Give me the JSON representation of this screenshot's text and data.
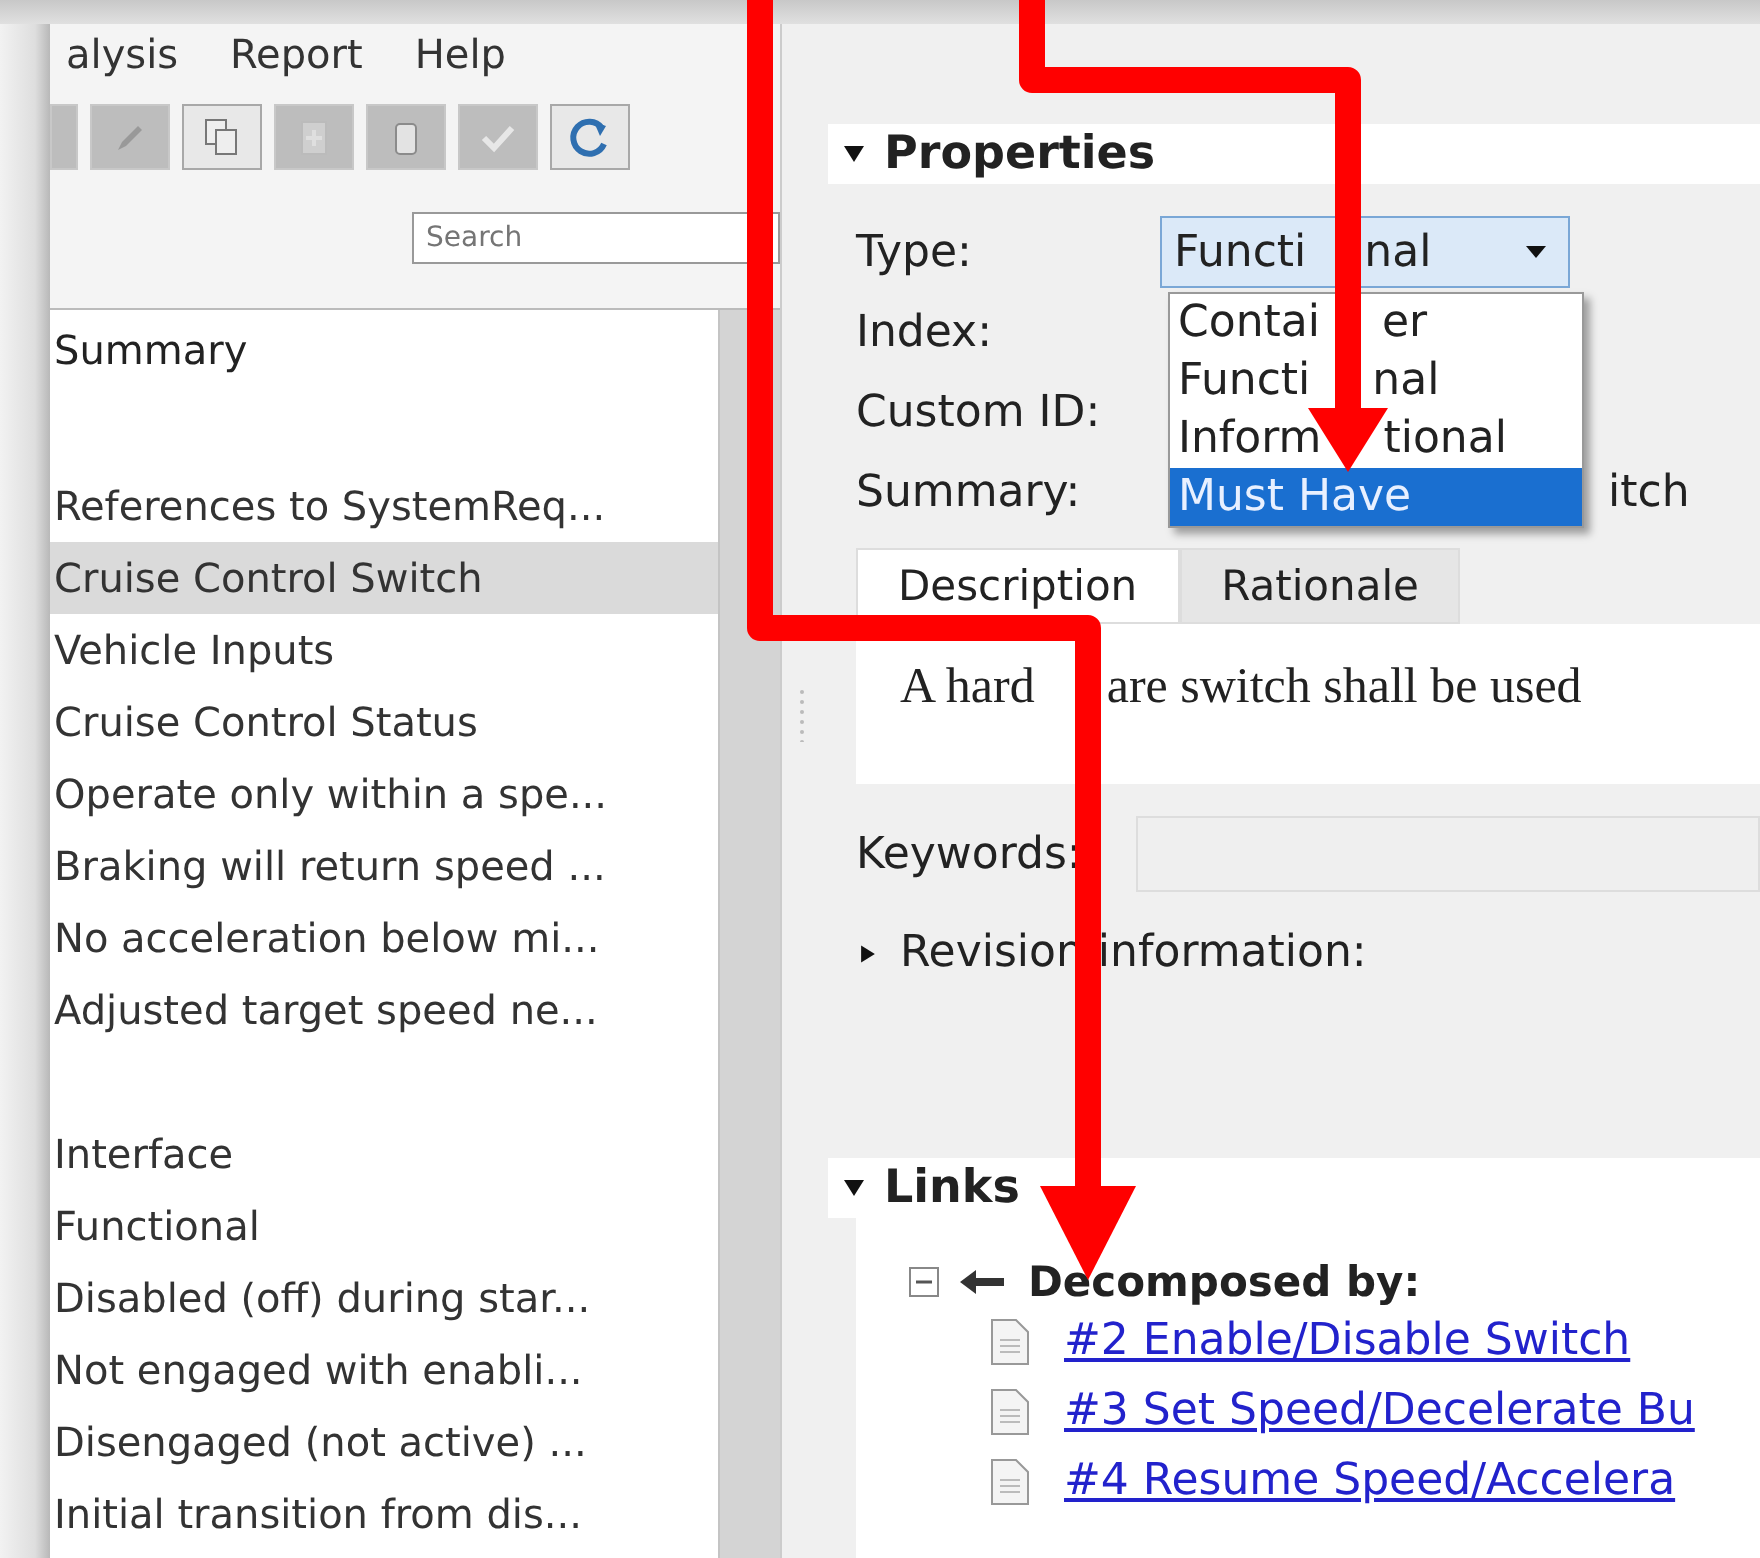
{
  "menu": [
    "alysis",
    "Report",
    "Help"
  ],
  "toolbar": [
    {
      "kind": "blank",
      "disabled": true
    },
    {
      "kind": "pencil",
      "disabled": true
    },
    {
      "kind": "copy",
      "disabled": false
    },
    {
      "kind": "add",
      "disabled": true
    },
    {
      "kind": "trash",
      "disabled": true
    },
    {
      "kind": "check",
      "disabled": true
    },
    {
      "kind": "refresh",
      "disabled": false
    }
  ],
  "search": {
    "placeholder": "Search"
  },
  "list": {
    "header": "Summary",
    "groups": [
      {
        "items": [
          {
            "label": "References to SystemReq...",
            "selected": false
          },
          {
            "label": "Cruise Control Switch",
            "selected": true
          },
          {
            "label": "Vehicle Inputs",
            "selected": false
          },
          {
            "label": "Cruise Control Status",
            "selected": false
          },
          {
            "label": "Operate only within a spe...",
            "selected": false
          },
          {
            "label": "Braking will return speed ...",
            "selected": false
          },
          {
            "label": "No acceleration below mi...",
            "selected": false
          },
          {
            "label": "Adjusted target speed ne...",
            "selected": false
          }
        ]
      },
      {
        "items": [
          {
            "label": "Interface",
            "selected": false
          },
          {
            "label": "Functional",
            "selected": false
          },
          {
            "label": "Disabled (off) during star...",
            "selected": false
          },
          {
            "label": "Not engaged with enabli...",
            "selected": false
          },
          {
            "label": "Disengaged (not active) ...",
            "selected": false
          },
          {
            "label": "Initial transition from dis...",
            "selected": false
          }
        ]
      }
    ]
  },
  "properties": {
    "title": "Properties",
    "expanded": true,
    "type": {
      "label": "Type:",
      "value": [
        "Functi",
        "nal"
      ],
      "options": [
        {
          "label": [
            "Contai",
            "er"
          ],
          "selected": false
        },
        {
          "label": [
            "Functi",
            "nal"
          ],
          "selected": false
        },
        {
          "label": [
            "Inform",
            "tional"
          ],
          "selected": false
        },
        {
          "label": [
            "Must Have"
          ],
          "selected": true
        }
      ]
    },
    "index": {
      "label": "Index:"
    },
    "custom_id": {
      "label": "Custom ID:"
    },
    "summary": {
      "label": "Summary:",
      "value": "itch"
    },
    "tabs": [
      {
        "label": "Description",
        "selected": true
      },
      {
        "label": "Rationale",
        "selected": false
      }
    ],
    "description": [
      "A hard",
      "are switch shall be used"
    ],
    "keywords": {
      "label": "Keywords:"
    },
    "revision": {
      "label": "Revision information:",
      "expanded": false
    }
  },
  "links": {
    "title": "Links",
    "expanded": true,
    "group": {
      "label": "Decomposed by:",
      "expanded": true,
      "items": [
        "#2 Enable/Disable Switch",
        "#3 Set Speed/Decelerate Bu",
        "#4 Resume Speed/Accelera"
      ]
    }
  }
}
